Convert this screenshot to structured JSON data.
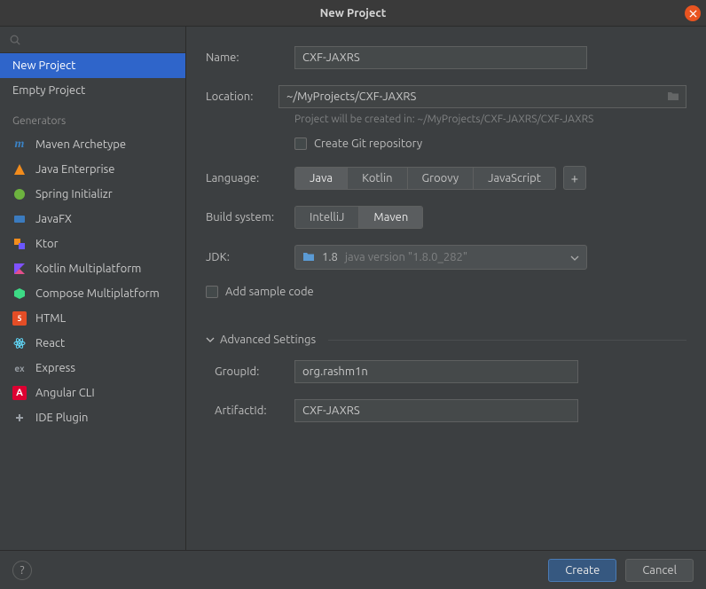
{
  "title": "New Project",
  "sidebar": {
    "top": [
      {
        "label": "New Project"
      },
      {
        "label": "Empty Project"
      }
    ],
    "generators_header": "Generators",
    "generators": [
      {
        "label": "Maven Archetype"
      },
      {
        "label": "Java Enterprise"
      },
      {
        "label": "Spring Initializr"
      },
      {
        "label": "JavaFX"
      },
      {
        "label": "Ktor"
      },
      {
        "label": "Kotlin Multiplatform"
      },
      {
        "label": "Compose Multiplatform"
      },
      {
        "label": "HTML"
      },
      {
        "label": "React"
      },
      {
        "label": "Express"
      },
      {
        "label": "Angular CLI"
      },
      {
        "label": "IDE Plugin"
      }
    ]
  },
  "form": {
    "name_label": "Name:",
    "name_value": "CXF-JAXRS",
    "location_label": "Location:",
    "location_value": "~/MyProjects/CXF-JAXRS",
    "location_hint": "Project will be created in: ~/MyProjects/CXF-JAXRS/CXF-JAXRS",
    "git_label": "Create Git repository",
    "language_label": "Language:",
    "languages": [
      "Java",
      "Kotlin",
      "Groovy",
      "JavaScript"
    ],
    "build_label": "Build system:",
    "builds": [
      "IntelliJ",
      "Maven"
    ],
    "jdk_label": "JDK:",
    "jdk_value": "1.8",
    "jdk_detail": "java version \"1.8.0_282\"",
    "sample_label": "Add sample code",
    "advanced_label": "Advanced Settings",
    "group_label": "GroupId:",
    "group_value": "org.rashm1n",
    "artifact_label": "ArtifactId:",
    "artifact_value": "CXF-JAXRS"
  },
  "footer": {
    "create": "Create",
    "cancel": "Cancel"
  }
}
